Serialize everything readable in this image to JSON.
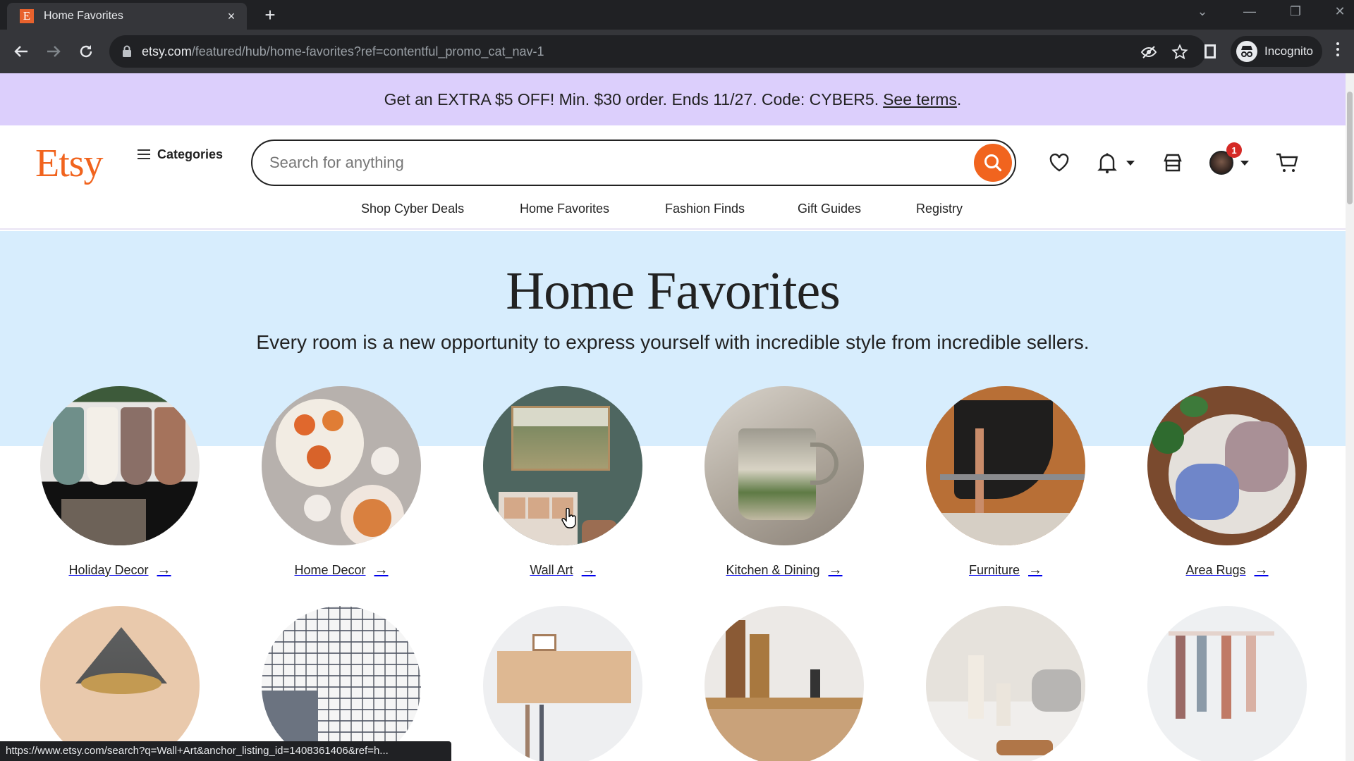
{
  "browser": {
    "tab": {
      "title": "Home Favorites",
      "favicon_letter": "E",
      "close_glyph": "×"
    },
    "new_tab_glyph": "+",
    "window_controls": {
      "tab_search": "⌄",
      "minimize": "—",
      "restore": "❐",
      "close": "✕"
    },
    "url": {
      "host": "etsy.com",
      "path": "/featured/hub/home-favorites?ref=contentful_promo_cat_nav-1"
    },
    "profile_label": "Incognito",
    "status_url": "https://www.etsy.com/search?q=Wall+Art&anchor_listing_id=1408361406&ref=h..."
  },
  "promo": {
    "text": "Get an EXTRA $5 OFF! Min. $30 order. Ends 11/27. Code: CYBER5.",
    "link": "See terms",
    "trailing": "."
  },
  "header": {
    "logo": "Etsy",
    "categories_label": "Categories",
    "search_placeholder": "Search for anything",
    "notification_count": "1",
    "accent_color": "#f1641e"
  },
  "subnav": [
    {
      "label": "Shop Cyber Deals"
    },
    {
      "label": "Home Favorites"
    },
    {
      "label": "Fashion Finds"
    },
    {
      "label": "Gift Guides"
    },
    {
      "label": "Registry"
    }
  ],
  "hero": {
    "title": "Home Favorites",
    "subtitle": "Every room is a new opportunity to express yourself with incredible style from incredible sellers."
  },
  "categories": [
    {
      "label": "Holiday Decor",
      "image": "christmas stockings on mantel"
    },
    {
      "label": "Home Decor",
      "image": "floral ceramic plates"
    },
    {
      "label": "Wall Art",
      "image": "landscape painting over shelf"
    },
    {
      "label": "Kitchen & Dining",
      "image": "green ceramic mug"
    },
    {
      "label": "Furniture",
      "image": "wood and leather sling chair"
    },
    {
      "label": "Area Rugs",
      "image": "abstract round rug"
    }
  ],
  "categories_row2": [
    {
      "image": "pendant lamp"
    },
    {
      "image": "checked pillow bedding"
    },
    {
      "image": "wooden pegboard"
    },
    {
      "image": "bottles on shelf"
    },
    {
      "image": "bath accessories set"
    },
    {
      "image": "hair bows"
    }
  ],
  "arrow_glyph": "→"
}
